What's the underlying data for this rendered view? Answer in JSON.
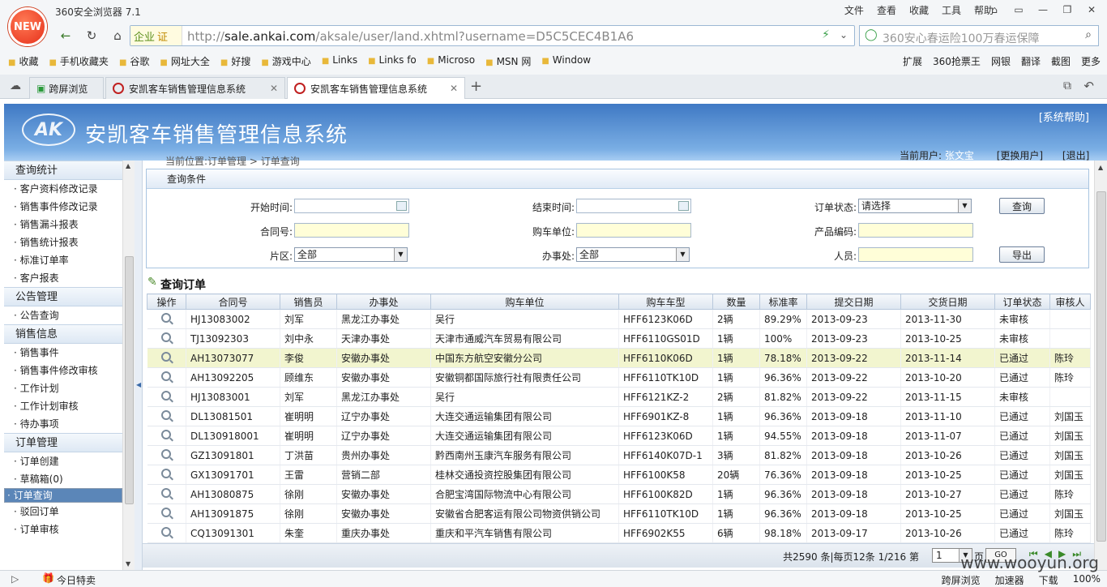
{
  "browser": {
    "app_name": "360安全浏览器 7.1",
    "menu": [
      "文件",
      "查看",
      "收藏",
      "工具",
      "帮助"
    ],
    "logo_text": "NEW",
    "enterprise_label": "企业",
    "url_host": "sale.ankai.com",
    "url_prefix": "http://",
    "url_path": "/aksale/user/land.xhtml?username=D5C5CEC4B1A6",
    "search_placeholder": "360安心春运险100万春运保障",
    "favorites": [
      "收藏",
      "手机收藏夹",
      "谷歌",
      "网址大全",
      "好搜",
      "游戏中心",
      "Links",
      "Links fo",
      "Microso",
      "MSN 网",
      "Window"
    ],
    "fav_right": [
      "扩展",
      "360抢票王",
      "网银",
      "翻译",
      "截图",
      "更多"
    ],
    "tabs": [
      "跨屏浏览",
      "安凯客车销售管理信息系统",
      "安凯客车销售管理信息系统"
    ],
    "status_today": "今日特卖",
    "status_right": [
      "跨屏浏览",
      "加速器",
      "下载",
      "100%"
    ]
  },
  "header": {
    "logo_text": "AK",
    "title": "安凯客车销售管理信息系统",
    "help": "[系统帮助]",
    "current_user_label": "当前用户:",
    "current_user": "张文宝",
    "switch_user": "[更换用户]",
    "logout": "[退出]"
  },
  "sidebar": {
    "sections": [
      {
        "title": "查询统计",
        "items": [
          "客户资料修改记录",
          "销售事件修改记录",
          "销售漏斗报表",
          "销售统计报表",
          "标准订单率",
          "客户报表"
        ]
      },
      {
        "title": "公告管理",
        "items": [
          "公告查询"
        ]
      },
      {
        "title": "销售信息",
        "items": [
          "销售事件",
          "销售事件修改审核",
          "工作计划",
          "工作计划审核",
          "待办事项"
        ]
      },
      {
        "title": "订单管理",
        "items": [
          "订单创建",
          "草稿箱(0)",
          "订单查询",
          "驳回订单",
          "订单审核"
        ]
      }
    ],
    "selected": "订单查询"
  },
  "main": {
    "breadcrumb": "当前位置:订单管理 > 订单查询",
    "query_title": "查询条件",
    "labels": {
      "start_time": "开始时间:",
      "end_time": "结束时间:",
      "order_status": "订单状态:",
      "contract_no": "合同号:",
      "buyer": "购车单位:",
      "product_code": "产品编码:",
      "area": "片区:",
      "office": "办事处:",
      "person": "人员:"
    },
    "values": {
      "order_status": "请选择",
      "area": "全部",
      "office": "全部"
    },
    "buttons": {
      "query": "查询",
      "export": "导出"
    },
    "orders_title": "查询订单",
    "columns": [
      "操作",
      "合同号",
      "销售员",
      "办事处",
      "购车单位",
      "购车车型",
      "数量",
      "标准率",
      "提交日期",
      "交货日期",
      "订单状态",
      "审核人"
    ],
    "rows": [
      [
        "HJ13083002",
        "刘军",
        "黑龙江办事处",
        "吴行",
        "HFF6123K06D",
        "2辆",
        "89.29%",
        "2013-09-23",
        "2013-11-30",
        "未审核",
        ""
      ],
      [
        "TJ13092303",
        "刘中永",
        "天津办事处",
        "天津市通威汽车贸易有限公司",
        "HFF6110GS01D",
        "1辆",
        "100%",
        "2013-09-23",
        "2013-10-25",
        "未审核",
        ""
      ],
      [
        "AH13073077",
        "李俊",
        "安徽办事处",
        "中国东方航空安徽分公司",
        "HFF6110K06D",
        "1辆",
        "78.18%",
        "2013-09-22",
        "2013-11-14",
        "已通过",
        "陈玲"
      ],
      [
        "AH13092205",
        "顾维东",
        "安徽办事处",
        "安徽铜都国际旅行社有限责任公司",
        "HFF6110TK10D",
        "1辆",
        "96.36%",
        "2013-09-22",
        "2013-10-20",
        "已通过",
        "陈玲"
      ],
      [
        "HJ13083001",
        "刘军",
        "黑龙江办事处",
        "吴行",
        "HFF6121KZ-2",
        "2辆",
        "81.82%",
        "2013-09-22",
        "2013-11-15",
        "未审核",
        ""
      ],
      [
        "DL13081501",
        "崔明明",
        "辽宁办事处",
        "大连交通运输集团有限公司",
        "HFF6901KZ-8",
        "1辆",
        "96.36%",
        "2013-09-18",
        "2013-11-10",
        "已通过",
        "刘国玉"
      ],
      [
        "DL130918001",
        "崔明明",
        "辽宁办事处",
        "大连交通运输集团有限公司",
        "HFF6123K06D",
        "1辆",
        "94.55%",
        "2013-09-18",
        "2013-11-07",
        "已通过",
        "刘国玉"
      ],
      [
        "GZ13091801",
        "丁洪苗",
        "贵州办事处",
        "黔西南州玉康汽车服务有限公司",
        "HFF6140K07D-1",
        "3辆",
        "81.82%",
        "2013-09-18",
        "2013-10-26",
        "已通过",
        "刘国玉"
      ],
      [
        "GX13091701",
        "王雷",
        "营销二部",
        "桂林交通投资控股集团有限公司",
        "HFF6100K58",
        "20辆",
        "76.36%",
        "2013-09-18",
        "2013-10-25",
        "已通过",
        "刘国玉"
      ],
      [
        "AH13080875",
        "徐刚",
        "安徽办事处",
        "合肥宝湾国际物流中心有限公司",
        "HFF6100K82D",
        "1辆",
        "96.36%",
        "2013-09-18",
        "2013-10-27",
        "已通过",
        "陈玲"
      ],
      [
        "AH13091875",
        "徐刚",
        "安徽办事处",
        "安徽省合肥客运有限公司物资供销公司",
        "HFF6110TK10D",
        "1辆",
        "96.36%",
        "2013-09-18",
        "2013-10-25",
        "已通过",
        "刘国玉"
      ],
      [
        "CQ13091301",
        "朱奎",
        "重庆办事处",
        "重庆和平汽车销售有限公司",
        "HFF6902K55",
        "6辆",
        "98.18%",
        "2013-09-17",
        "2013-10-26",
        "已通过",
        "陈玲"
      ]
    ],
    "highlight_row": 2,
    "pager": {
      "summary": "共2590 条|每页12条 1/216 第",
      "page": "1",
      "suffix": "页",
      "go": "GO"
    }
  },
  "watermark": "www.wooyun.org"
}
